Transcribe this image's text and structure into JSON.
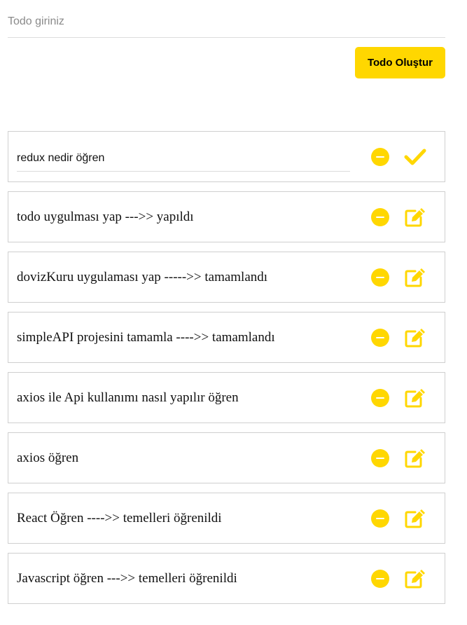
{
  "form": {
    "input_value": "",
    "input_placeholder": "Todo giriniz",
    "create_button_label": "Todo Oluştur"
  },
  "colors": {
    "accent": "#ffd700",
    "border": "#cfcfcf"
  },
  "todos": [
    {
      "text": "redux nedir öğren",
      "mode": "editing",
      "remove_icon": "minus-circle-icon",
      "action_icon": "check-icon"
    },
    {
      "text": "todo uygulması yap --->> yapıldı",
      "mode": "view",
      "remove_icon": "minus-circle-icon",
      "action_icon": "edit-icon"
    },
    {
      "text": "dovizKuru uygulaması yap ----->> tamamlandı",
      "mode": "view",
      "remove_icon": "minus-circle-icon",
      "action_icon": "edit-icon"
    },
    {
      "text": "simpleAPI projesini tamamla ---->> tamamlandı",
      "mode": "view",
      "remove_icon": "minus-circle-icon",
      "action_icon": "edit-icon"
    },
    {
      "text": "axios ile Api kullanımı nasıl yapılır öğren",
      "mode": "view",
      "remove_icon": "minus-circle-icon",
      "action_icon": "edit-icon"
    },
    {
      "text": "axios öğren",
      "mode": "view",
      "remove_icon": "minus-circle-icon",
      "action_icon": "edit-icon"
    },
    {
      "text": "React Öğren ---->> temelleri öğrenildi",
      "mode": "view",
      "remove_icon": "minus-circle-icon",
      "action_icon": "edit-icon"
    },
    {
      "text": "Javascript öğren --->> temelleri öğrenildi",
      "mode": "view",
      "remove_icon": "minus-circle-icon",
      "action_icon": "edit-icon"
    }
  ]
}
